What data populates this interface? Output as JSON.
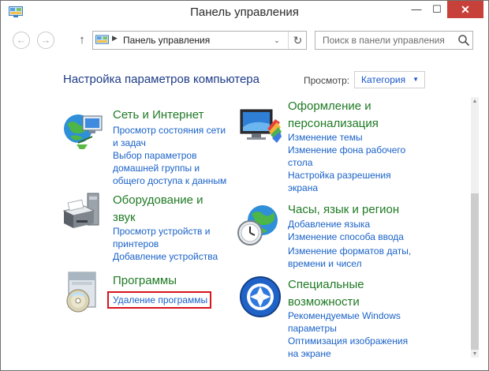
{
  "window": {
    "title": "Панель управления",
    "icon": "control-panel-icon",
    "controls": {
      "minimize": "—",
      "maximize": "☐",
      "close": "✕"
    }
  },
  "nav": {
    "back_glyph": "←",
    "forward_glyph": "→",
    "up_glyph": "↑",
    "breadcrumb_separator": "▶",
    "address": "Панель управления",
    "dropdown_glyph": "⌄",
    "refresh_glyph": "↻",
    "search_placeholder": "Поиск в панели управления"
  },
  "content": {
    "heading": "Настройка параметров компьютера",
    "view_label": "Просмотр:",
    "view_value": "Категория",
    "view_arrow": "▼"
  },
  "categories": [
    {
      "icon": "network-globe-icon",
      "title": [
        "Сеть и Интернет"
      ],
      "links": [
        [
          "Просмотр состояния сети",
          "и задач"
        ],
        [
          "Выбор параметров",
          "домашней группы и",
          "общего доступа к данным"
        ]
      ]
    },
    {
      "icon": "appearance-monitor-icon",
      "title": [
        "Оформление и",
        "персонализация"
      ],
      "links": [
        [
          "Изменение темы"
        ],
        [
          "Изменение фона рабочего",
          "стола"
        ],
        [
          "Настройка разрешения",
          "экрана"
        ]
      ]
    },
    {
      "icon": "printer-hardware-icon",
      "title": [
        "Оборудование и",
        "звук"
      ],
      "links": [
        [
          "Просмотр устройств и",
          "принтеров"
        ],
        [
          "Добавление устройства"
        ]
      ]
    },
    {
      "icon": "clock-globe-icon",
      "title": [
        "Часы, язык и регион"
      ],
      "links": [
        [
          "Добавление языка"
        ],
        [
          "Изменение способа ввода"
        ],
        [
          "Изменение форматов даты,",
          "времени и чисел"
        ]
      ]
    },
    {
      "icon": "programs-disc-icon",
      "title": [
        "Программы"
      ],
      "links": [
        [
          "Удаление программы"
        ]
      ]
    },
    {
      "icon": "ease-of-access-icon",
      "title": [
        "Специальные",
        "возможности"
      ],
      "links": [
        [
          "Рекомендуемые Windows",
          "параметры"
        ],
        [
          "Оптимизация изображения",
          "на экране"
        ]
      ]
    }
  ],
  "colors": {
    "category_title": "#1f7a24",
    "link": "#1a62c8",
    "heading": "#1d3b86",
    "highlight": "#d7131b",
    "close_button": "#c7413a"
  }
}
